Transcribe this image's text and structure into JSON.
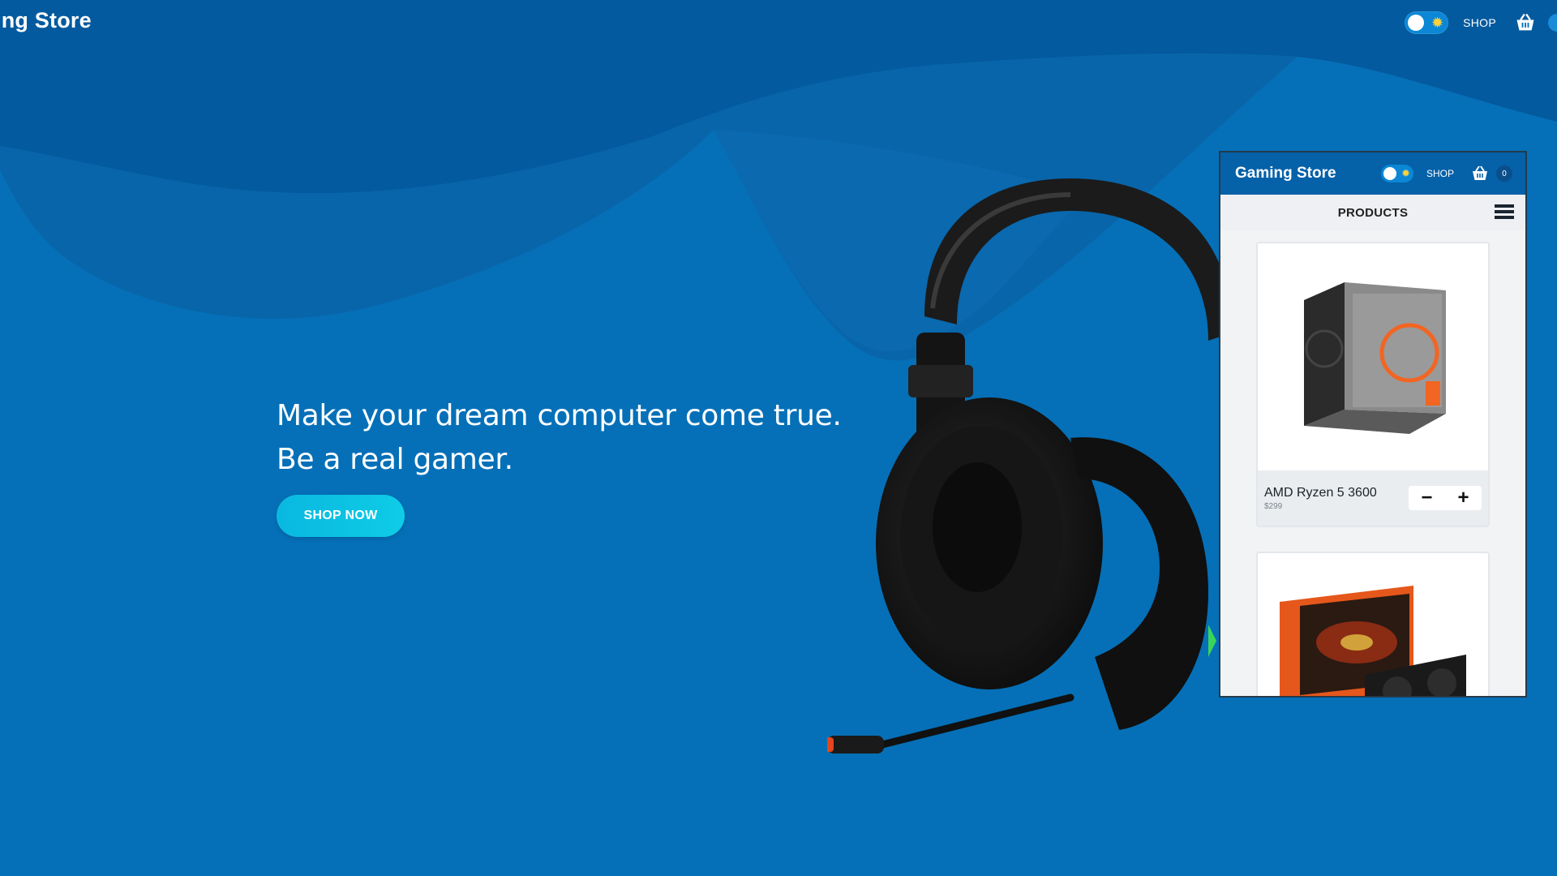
{
  "header": {
    "logo": "ing Store",
    "nav_shop": "SHOP",
    "cart_count": ""
  },
  "hero": {
    "line1": "Make your dream computer come true.",
    "line2": "Be a real gamer.",
    "cta": "SHOP NOW"
  },
  "mobile_preview": {
    "logo": "Gaming Store",
    "nav_shop": "SHOP",
    "cart_count": "0",
    "section_title": "PRODUCTS",
    "products": [
      {
        "name": "AMD Ryzen 5 3600",
        "price": "$299",
        "image": "amd-ryzen-box"
      },
      {
        "name": "",
        "price": "",
        "image": "gigabyte-radeon-gpu-box"
      }
    ]
  },
  "colors": {
    "background": "#0570b8",
    "wave_dark": "#045a9e",
    "wave_mid": "#0a64a8",
    "button_gradient_start": "#0ab8e0",
    "button_gradient_end": "#0ecce6",
    "mobile_header": "#0561a8"
  },
  "icons": [
    "sun-icon",
    "basket-icon",
    "menu-icon",
    "minus-icon",
    "plus-icon"
  ]
}
